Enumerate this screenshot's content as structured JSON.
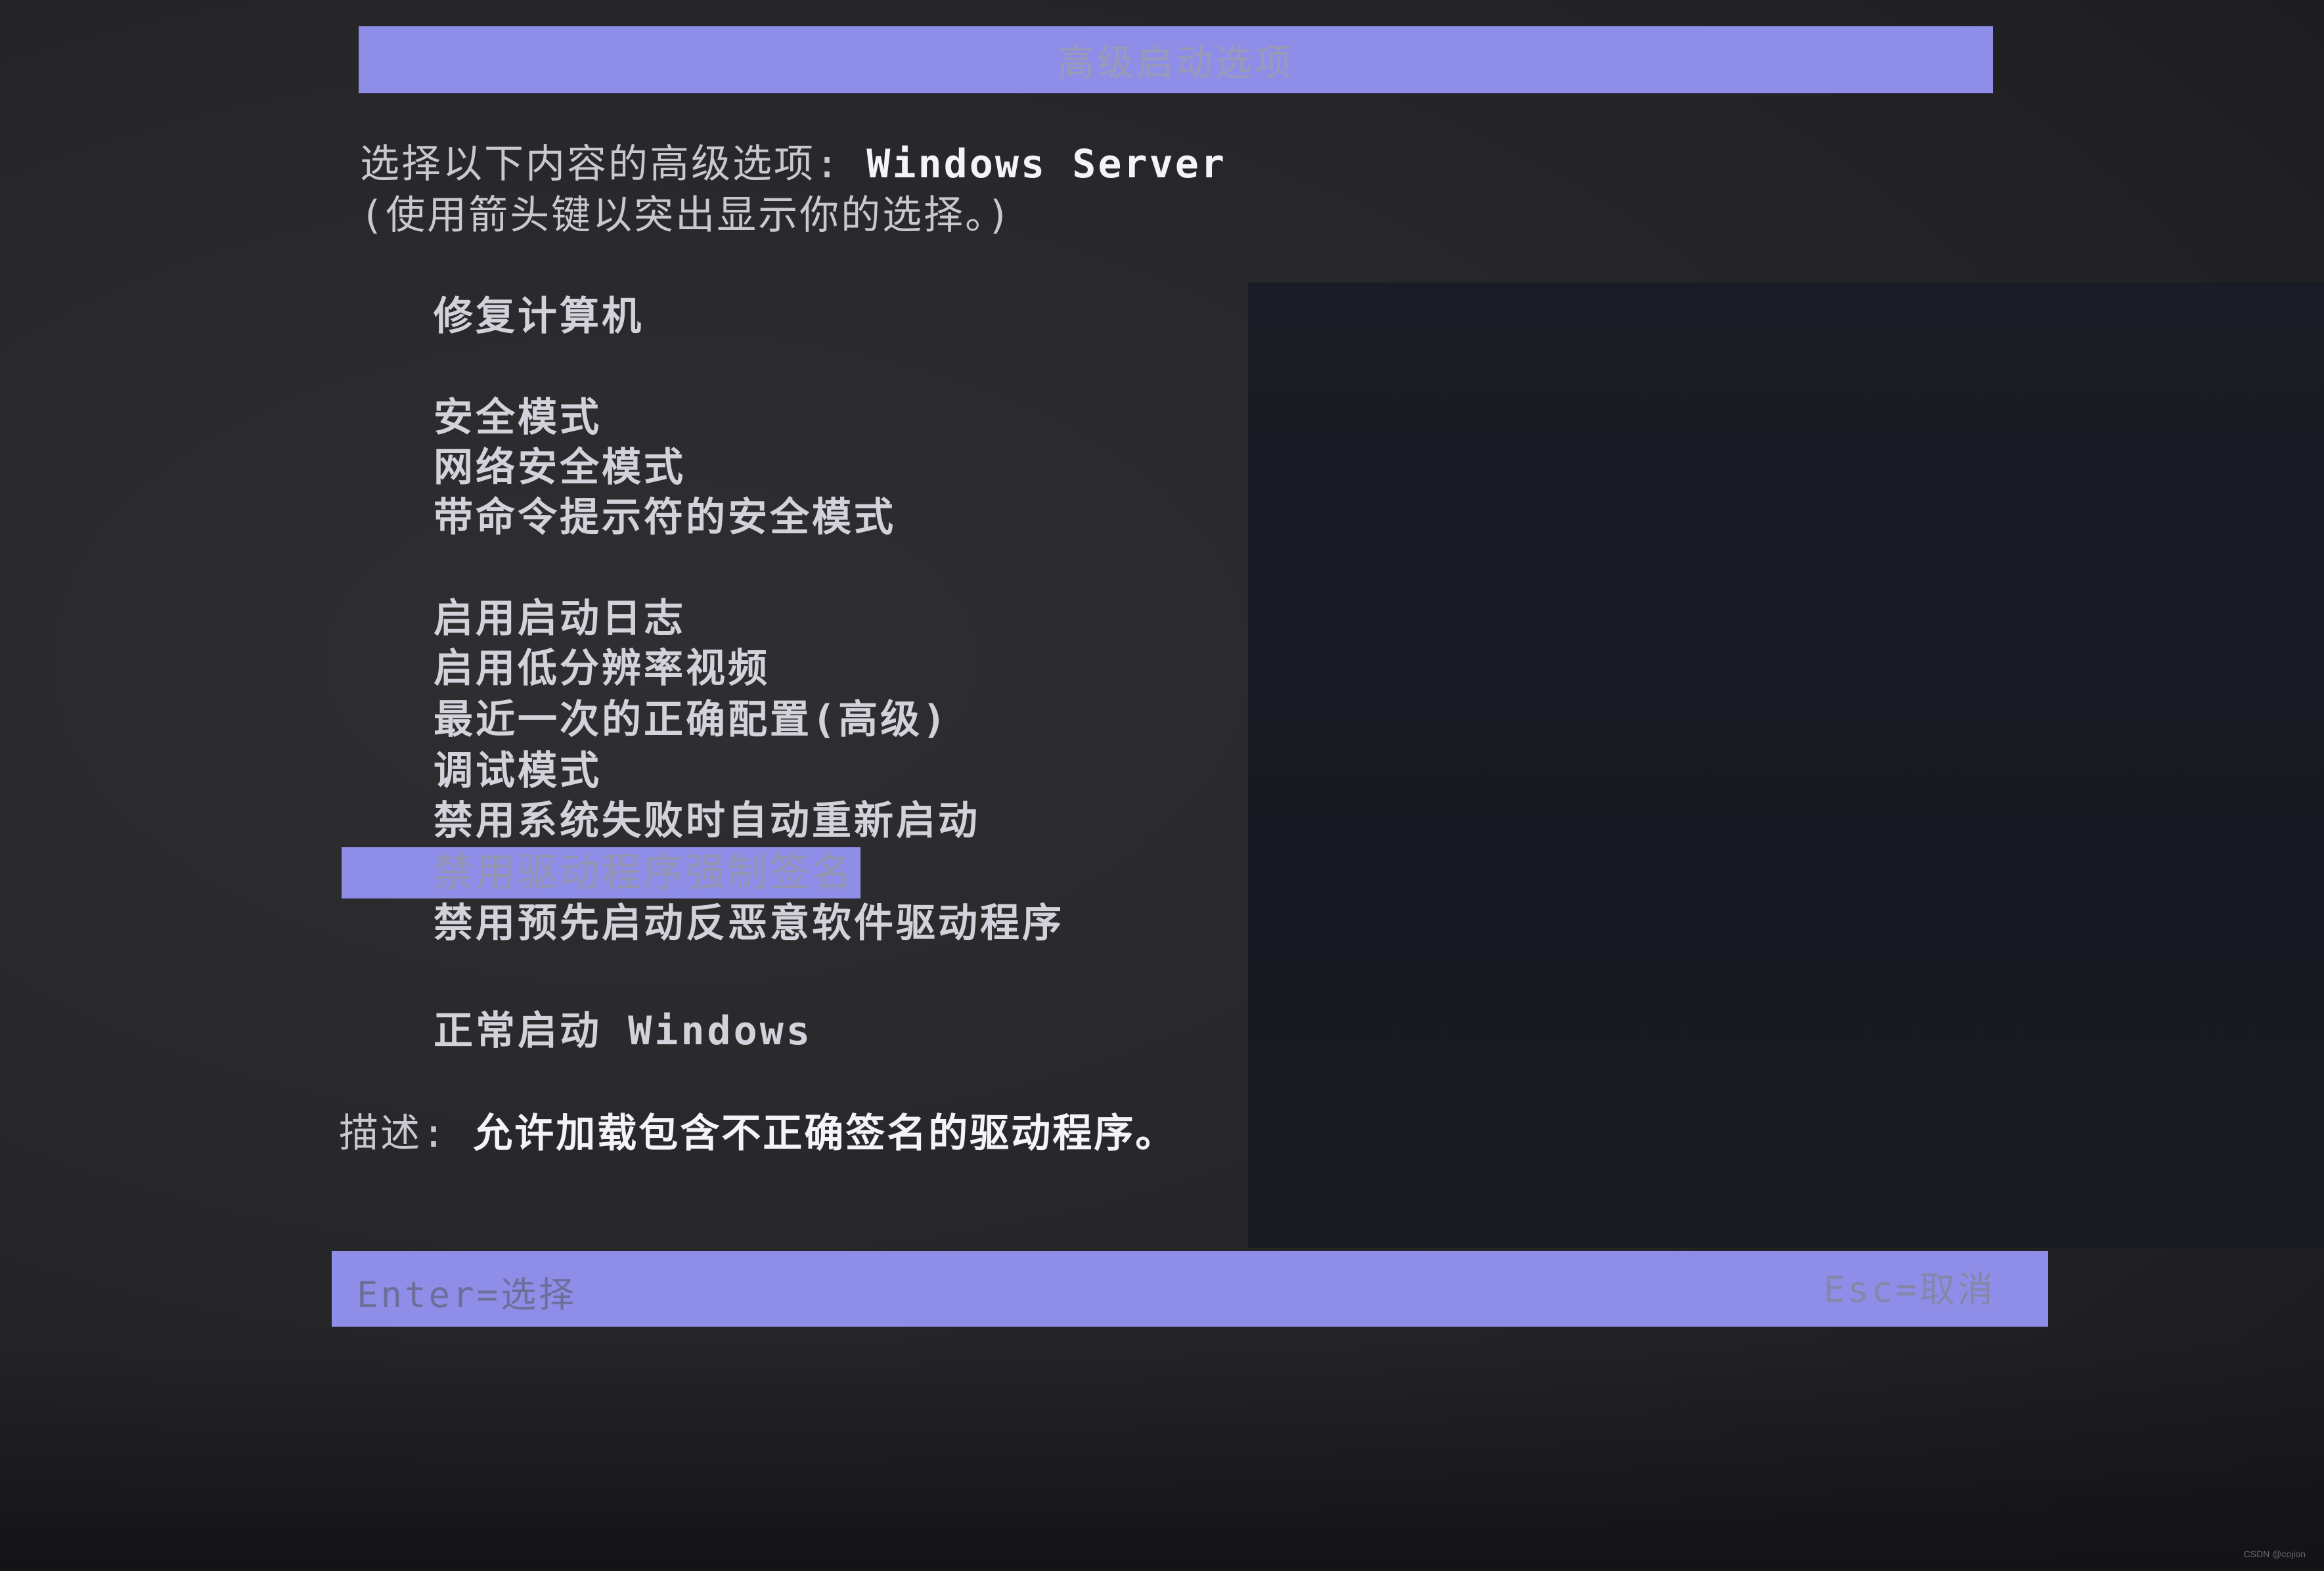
{
  "header": {
    "title": "高级启动选项"
  },
  "prompt": {
    "line1_prefix": "选择以下内容的高级选项: ",
    "os_name": "Windows Server",
    "line2": "(使用箭头键以突出显示你的选择。)"
  },
  "menu": {
    "items": [
      {
        "label": "修复计算机"
      },
      {
        "label": "安全模式"
      },
      {
        "label": "网络安全模式"
      },
      {
        "label": "带命令提示符的安全模式"
      },
      {
        "label": "启用启动日志"
      },
      {
        "label": "启用低分辨率视频"
      },
      {
        "label": "最近一次的正确配置(高级)"
      },
      {
        "label": "调试模式"
      },
      {
        "label": "禁用系统失败时自动重新启动"
      },
      {
        "label": "禁用驱动程序强制签名",
        "selected": true
      },
      {
        "label": "禁用预先启动反恶意软件驱动程序"
      },
      {
        "label": "正常启动 Windows"
      }
    ]
  },
  "description": {
    "label": "描述: ",
    "text": "允许加载包含不正确签名的驱动程序。"
  },
  "footer": {
    "left": "Enter=选择",
    "right": "Esc=取消"
  },
  "watermark": "CSDN @cojion",
  "colors": {
    "highlight": "#8e8ee8",
    "background": "#232326",
    "text": "#d2d2da"
  }
}
